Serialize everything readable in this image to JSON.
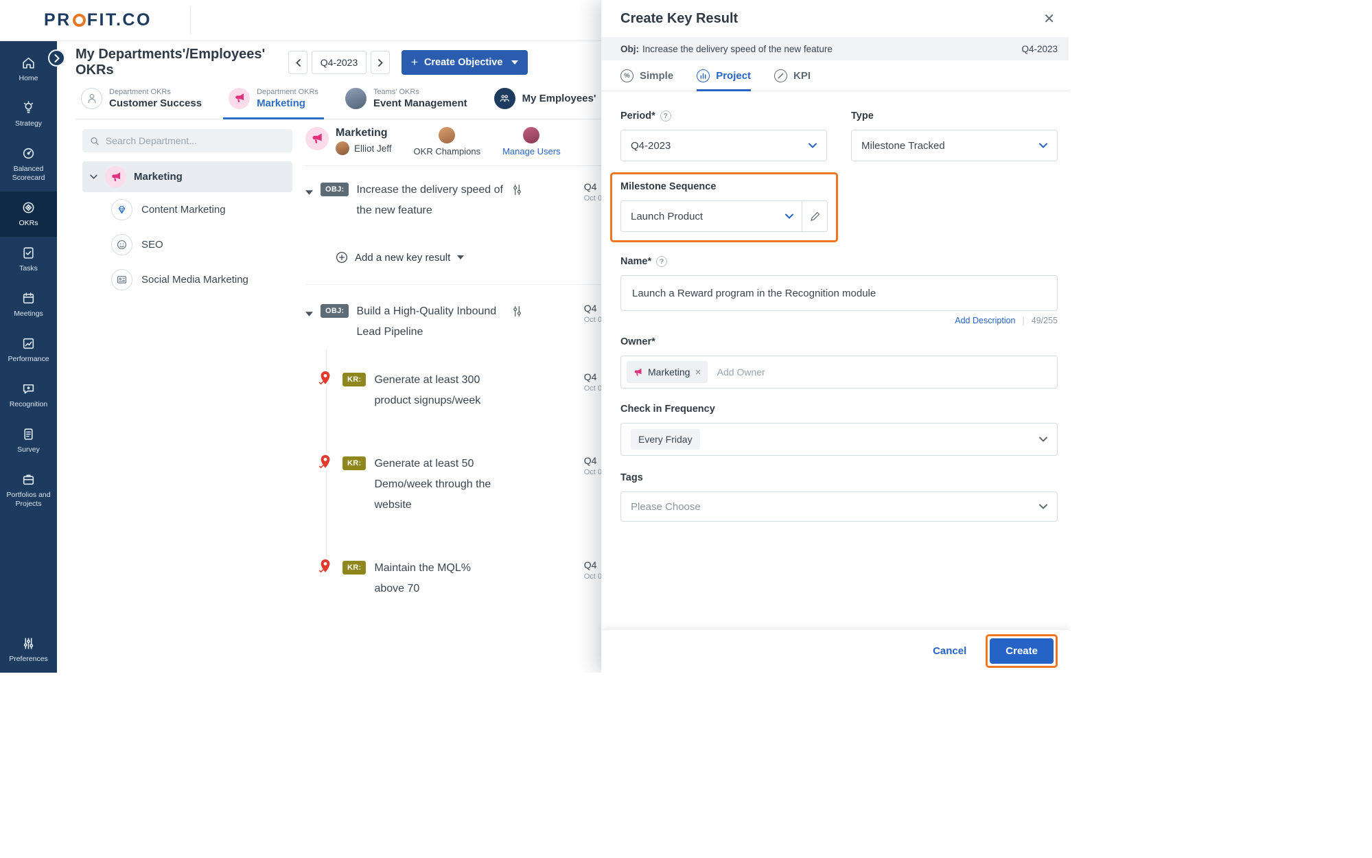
{
  "colors": {
    "sidebar_bg": "#1c3b5e",
    "sidebar_active_bg": "#0f2a47",
    "accent_blue": "#2563c7",
    "primary_button_blue": "#2a5db0",
    "annotation_orange": "#f0751f",
    "brand_navy": "#1c3b5e",
    "brand_orange": "#e87722",
    "obj_badge": "#5d6b77",
    "kr_badge": "#8f871d",
    "pin_red": "#e23b2e",
    "marketing_pink": "#e0317e"
  },
  "brand": {
    "name": "PROFIT.CO",
    "pre": "PR",
    "post": "FIT.CO"
  },
  "sidebar": {
    "items": [
      {
        "label": "Home",
        "icon": "home-icon",
        "active": false
      },
      {
        "label": "Strategy",
        "icon": "strategy-icon",
        "active": false
      },
      {
        "label": "Balanced Scorecard",
        "icon": "balanced-scorecard-icon",
        "active": false
      },
      {
        "label": "OKRs",
        "icon": "okrs-icon",
        "active": true
      },
      {
        "label": "Tasks",
        "icon": "tasks-icon",
        "active": false
      },
      {
        "label": "Meetings",
        "icon": "meetings-icon",
        "active": false
      },
      {
        "label": "Performance",
        "icon": "performance-icon",
        "active": false
      },
      {
        "label": "Recognition",
        "icon": "recognition-icon",
        "active": false
      },
      {
        "label": "Survey",
        "icon": "survey-icon",
        "active": false
      },
      {
        "label": "Portfolios and Projects",
        "icon": "portfolios-icon",
        "active": false
      },
      {
        "label": "Preferences",
        "icon": "preferences-icon",
        "active": false
      }
    ]
  },
  "topbar": {
    "title": "My Departments'/Employees' OKRs",
    "period": "Q4-2023",
    "create_objective_label": "Create Objective"
  },
  "okr_tabs": [
    {
      "category": "Department OKRs",
      "name": "Customer Success",
      "active": false
    },
    {
      "category": "Department OKRs",
      "name": "Marketing",
      "active": true
    },
    {
      "category": "Teams' OKRs",
      "name": "Event Management",
      "active": false
    },
    {
      "category": "",
      "name": "My Employees'",
      "active": false
    }
  ],
  "tree": {
    "search_placeholder": "Search Department...",
    "root_label": "Marketing",
    "children": [
      {
        "label": "Content Marketing",
        "icon": "gem-icon"
      },
      {
        "label": "SEO",
        "icon": "smiley-icon"
      },
      {
        "label": "Social Media Marketing",
        "icon": "social-card-icon"
      }
    ]
  },
  "panel": {
    "team": "Marketing",
    "owner": "Elliot Jeff",
    "champions_label": "OKR Champions",
    "manage_users_label": "Manage Users",
    "add_kr_label": "Add a new key result",
    "objectives": [
      {
        "badge": "OBJ:",
        "title": "Increase the delivery speed of the new feature",
        "period": "Q4",
        "date": "Oct 0"
      },
      {
        "badge": "OBJ:",
        "title": "Build a High-Quality Inbound Lead Pipeline",
        "period": "Q4",
        "date": "Oct 0",
        "krs": [
          {
            "badge": "KR:",
            "title": "Generate at least 300 product signups/week",
            "period": "Q4",
            "date": "Oct 0"
          },
          {
            "badge": "KR:",
            "title": "Generate at least 50 Demo/week through the website",
            "period": "Q4",
            "date": "Oct 0"
          },
          {
            "badge": "KR:",
            "title": "Maintain the MQL% above 70",
            "period": "Q4",
            "date": "Oct 0"
          }
        ]
      }
    ]
  },
  "drawer": {
    "title": "Create Key Result",
    "objective": {
      "prefix": "Obj:",
      "text": "Increase the delivery speed of the new feature",
      "period": "Q4-2023"
    },
    "tabs": [
      {
        "label": "Simple",
        "icon": "percent-icon",
        "active": false
      },
      {
        "label": "Project",
        "icon": "project-icon",
        "active": true
      },
      {
        "label": "KPI",
        "icon": "kpi-icon",
        "active": false
      }
    ],
    "fields": {
      "period": {
        "label": "Period*",
        "value": "Q4-2023"
      },
      "type": {
        "label": "Type",
        "value": "Milestone Tracked"
      },
      "milestone": {
        "label": "Milestone Sequence",
        "value": "Launch Product"
      },
      "name": {
        "label": "Name*",
        "value": "Launch a Reward program in the Recognition module",
        "add_description_label": "Add Description",
        "char_counter": "49/255"
      },
      "owner": {
        "label": "Owner*",
        "chip": "Marketing",
        "placeholder": "Add Owner"
      },
      "frequency": {
        "label": "Check in Frequency",
        "value": "Every Friday"
      },
      "tags": {
        "label": "Tags",
        "placeholder": "Please Choose"
      }
    },
    "footer": {
      "cancel_label": "Cancel",
      "create_label": "Create"
    }
  }
}
